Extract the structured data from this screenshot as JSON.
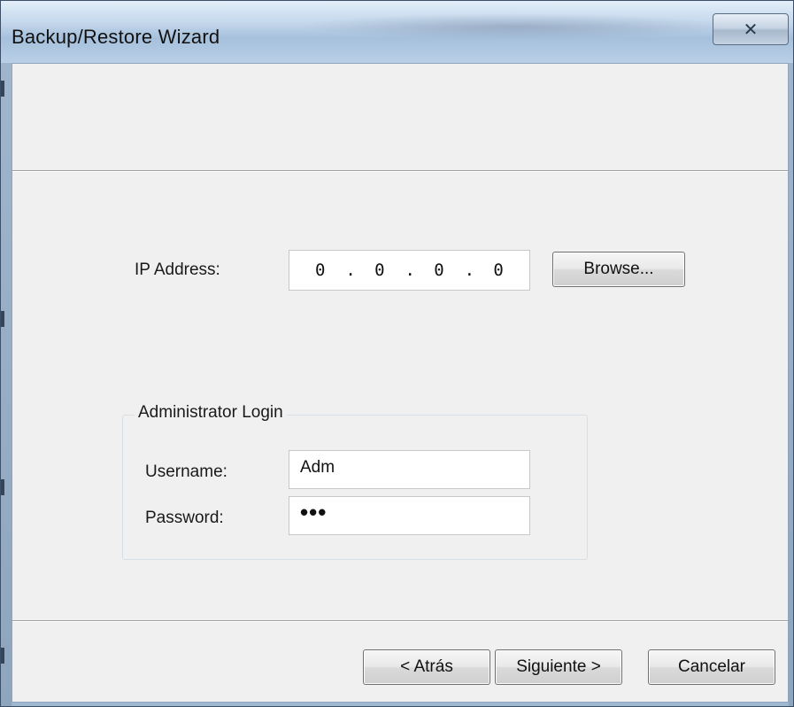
{
  "window": {
    "title": "Backup/Restore Wizard",
    "close_icon": "close-icon"
  },
  "ip": {
    "label": "IP Address:",
    "octets": [
      "0",
      "0",
      "0",
      "0"
    ],
    "dot": ".",
    "browse_label": "Browse..."
  },
  "login": {
    "group_label": "Administrator Login",
    "username_label": "Username:",
    "username_value": "Adm",
    "password_label": "Password:",
    "password_value": "•••"
  },
  "buttons": {
    "back": "< Atrás",
    "next": "Siguiente >",
    "cancel": "Cancelar"
  },
  "colors": {
    "title_bar": "#b9cfe6",
    "client_bg": "#f0f0f0"
  }
}
